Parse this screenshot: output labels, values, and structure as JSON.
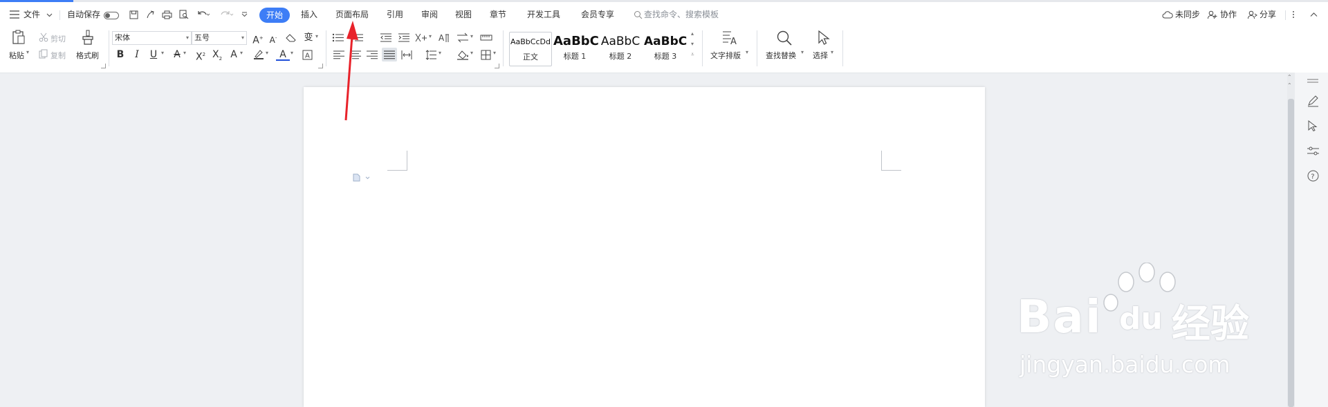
{
  "menubar": {
    "file": "文件",
    "autosave": "自动保存",
    "tabs": [
      "开始",
      "插入",
      "页面布局",
      "引用",
      "审阅",
      "视图",
      "章节",
      "开发工具",
      "会员专享"
    ],
    "search_placeholder": "查找命令、搜索模板",
    "sync": "未同步",
    "collab": "协作",
    "share": "分享"
  },
  "ribbon": {
    "paste": "粘贴",
    "cut": "剪切",
    "copy": "复制",
    "format_painter": "格式刷",
    "font_name": "宋体",
    "font_size": "五号",
    "styles": [
      {
        "sample": "AaBbCcDd",
        "name": "正文"
      },
      {
        "sample": "AaBbC",
        "name": "标题 1"
      },
      {
        "sample": "AaBbC",
        "name": "标题 2"
      },
      {
        "sample": "AaBbC",
        "name": "标题 3"
      }
    ],
    "text_layout": "文字排版",
    "find_replace": "查找替换",
    "select": "选择"
  },
  "watermark": {
    "logo": "Bai",
    "logo2": "du",
    "logo_cn": "经验",
    "url": "jingyan.baidu.com"
  },
  "colors": {
    "accent": "#3d7df6",
    "annotation_arrow": "#e8222a"
  }
}
